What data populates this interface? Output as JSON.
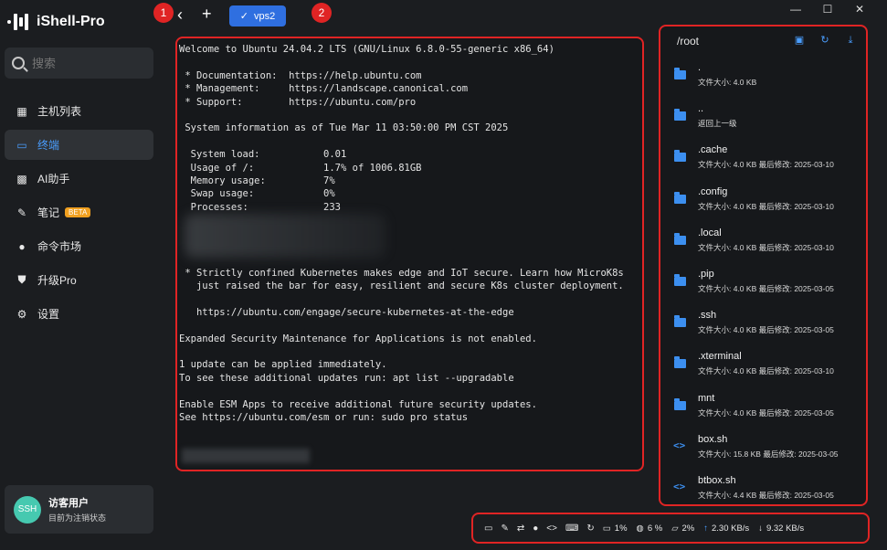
{
  "app": {
    "name": "iShell-Pro"
  },
  "search": {
    "placeholder": "搜索"
  },
  "sidebar": {
    "items": [
      {
        "label": "主机列表",
        "icon": "grid-icon",
        "active": false
      },
      {
        "label": "终端",
        "icon": "terminal-icon",
        "active": true
      },
      {
        "label": "AI助手",
        "icon": "ai-chip-icon",
        "active": false
      },
      {
        "label": "笔记",
        "icon": "note-pen-icon",
        "active": false,
        "badge": "BETA"
      },
      {
        "label": "命令市场",
        "icon": "bulb-icon",
        "active": false
      },
      {
        "label": "升级Pro",
        "icon": "shield-icon",
        "active": false
      },
      {
        "label": "设置",
        "icon": "gear-icon",
        "active": false
      }
    ]
  },
  "user": {
    "avatar": "SSH",
    "name": "访客用户",
    "status": "目前为注销状态"
  },
  "topbar": {
    "tab_label": "vps2",
    "marker1": "1",
    "marker2": "2"
  },
  "terminal": {
    "lines": [
      "Welcome to Ubuntu 24.04.2 LTS (GNU/Linux 6.8.0-55-generic x86_64)",
      "",
      " * Documentation:  https://help.ubuntu.com",
      " * Management:     https://landscape.canonical.com",
      " * Support:        https://ubuntu.com/pro",
      "",
      " System information as of Tue Mar 11 03:50:00 PM CST 2025",
      "",
      "  System load:           0.01",
      "  Usage of /:            1.7% of 1006.81GB",
      "  Memory usage:          7%",
      "  Swap usage:            0%",
      "  Processes:             233",
      "",
      "",
      "",
      "",
      " * Strictly confined Kubernetes makes edge and IoT secure. Learn how MicroK8s",
      "   just raised the bar for easy, resilient and secure K8s cluster deployment.",
      "",
      "   https://ubuntu.com/engage/secure-kubernetes-at-the-edge",
      "",
      "Expanded Security Maintenance for Applications is not enabled.",
      "",
      "1 update can be applied immediately.",
      "To see these additional updates run: apt list --upgradable",
      "",
      "Enable ESM Apps to receive additional future security updates.",
      "See https://ubuntu.com/esm or run: sudo pro status"
    ]
  },
  "files": {
    "path": "/root",
    "items": [
      {
        "name": ".",
        "meta": "文件大小: 4.0 KB",
        "type": "folder"
      },
      {
        "name": "..",
        "meta": "返回上一级",
        "type": "folder"
      },
      {
        "name": ".cache",
        "meta": "文件大小: 4.0 KB     最后修改: 2025-03-10",
        "type": "folder"
      },
      {
        "name": ".config",
        "meta": "文件大小: 4.0 KB     最后修改: 2025-03-10",
        "type": "folder"
      },
      {
        "name": ".local",
        "meta": "文件大小: 4.0 KB     最后修改: 2025-03-10",
        "type": "folder"
      },
      {
        "name": ".pip",
        "meta": "文件大小: 4.0 KB     最后修改: 2025-03-05",
        "type": "folder"
      },
      {
        "name": ".ssh",
        "meta": "文件大小: 4.0 KB     最后修改: 2025-03-05",
        "type": "folder"
      },
      {
        "name": ".xterminal",
        "meta": "文件大小: 4.0 KB     最后修改: 2025-03-10",
        "type": "folder"
      },
      {
        "name": "mnt",
        "meta": "文件大小: 4.0 KB     最后修改: 2025-03-05",
        "type": "folder"
      },
      {
        "name": "box.sh",
        "meta": "文件大小: 15.8 KB   最后修改: 2025-03-05",
        "type": "code"
      },
      {
        "name": "btbox.sh",
        "meta": "文件大小: 4.4 KB     最后修改: 2025-03-05",
        "type": "code"
      }
    ]
  },
  "statusbar": {
    "cpu": "1%",
    "mem": "6 %",
    "disk": "2%",
    "upload": "2.30 KB/s",
    "download": "9.32 KB/s"
  }
}
